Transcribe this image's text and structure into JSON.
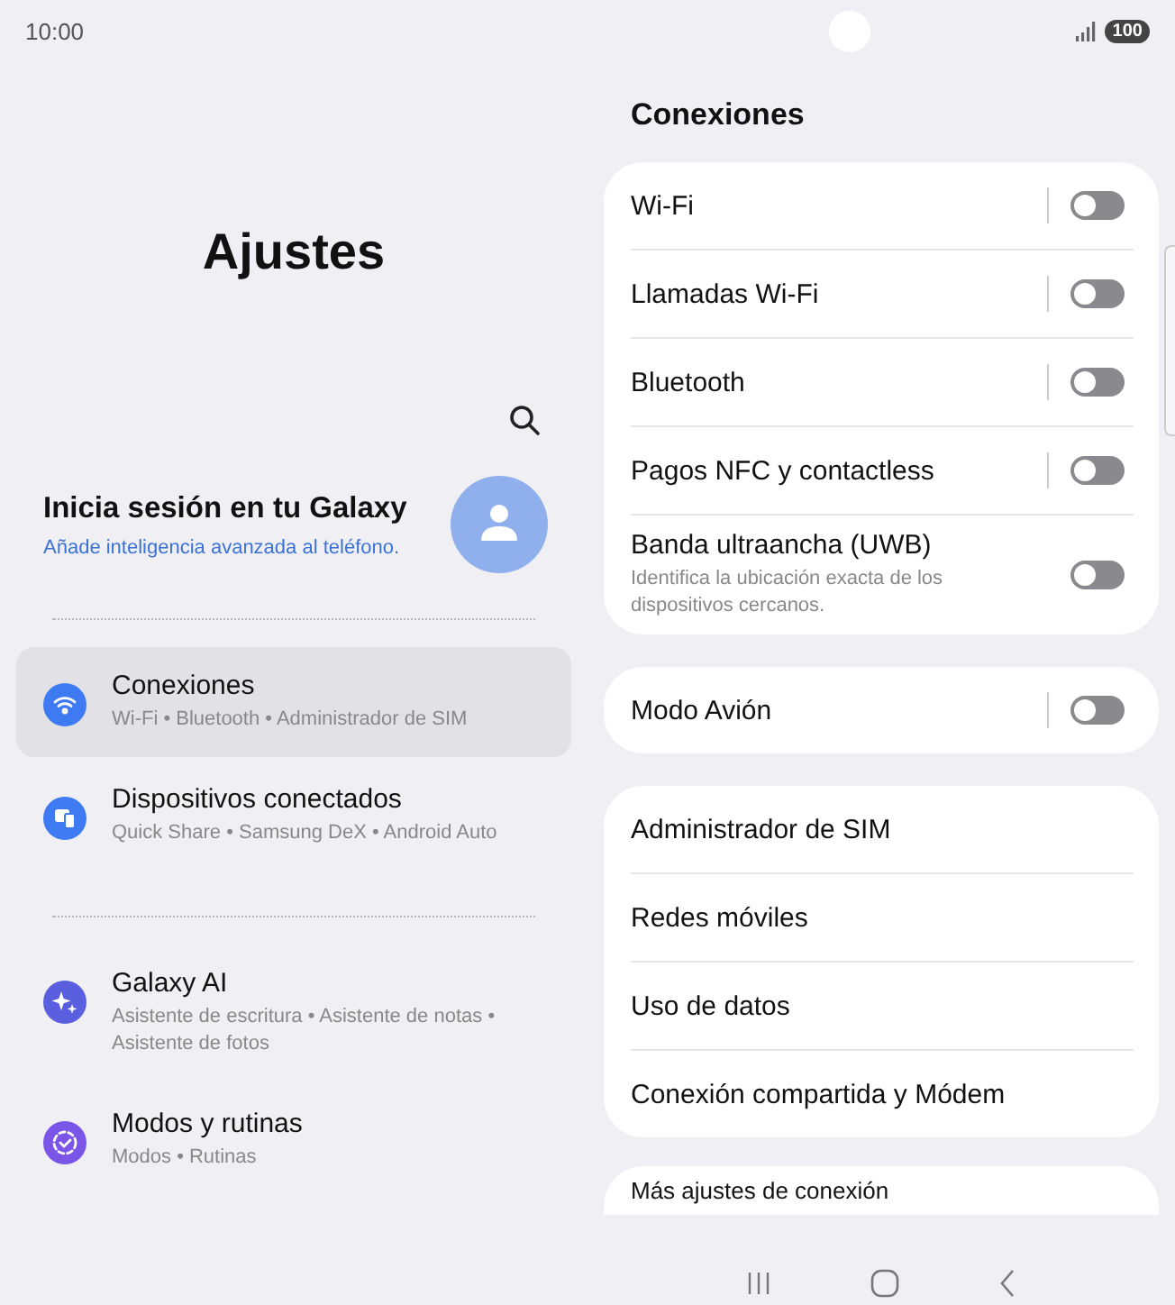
{
  "status_bar": {
    "time": "10:00",
    "battery": "100"
  },
  "sidebar": {
    "title": "Ajustes",
    "account": {
      "title": "Inicia sesión en tu Galaxy",
      "subtitle": "Añade inteligencia avanzada al teléfono."
    },
    "groups": [
      [
        {
          "title": "Conexiones",
          "subtitle": "Wi-Fi  •  Bluetooth  •  Administrador de SIM",
          "kind": "wifi",
          "color": "#3e7bf2",
          "selected": true
        },
        {
          "title": "Dispositivos conectados",
          "subtitle": "Quick Share  •  Samsung DeX  •  Android Auto",
          "kind": "devices",
          "color": "#3e7bf2",
          "selected": false
        }
      ],
      [
        {
          "title": "Galaxy AI",
          "subtitle": "Asistente de escritura  •  Asistente de notas  •  Asistente de fotos",
          "kind": "sparkle",
          "color": "#5a5fe0",
          "selected": false
        },
        {
          "title": "Modos y rutinas",
          "subtitle": "Modos  •  Rutinas",
          "kind": "routine",
          "color": "#7a55e8",
          "selected": false
        }
      ]
    ]
  },
  "detail": {
    "title": "Conexiones",
    "cards": [
      [
        {
          "label": "Wi-Fi",
          "on": false,
          "split": true
        },
        {
          "label": "Llamadas Wi-Fi",
          "on": false,
          "split": true
        },
        {
          "label": "Bluetooth",
          "on": false,
          "split": true
        },
        {
          "label": "Pagos NFC y contactless",
          "on": false,
          "split": true
        },
        {
          "label": "Banda ultraancha (UWB)",
          "description": "Identifica la ubicación exacta de los dispositivos cercanos.",
          "on": false,
          "split": false
        }
      ],
      [
        {
          "label": "Modo Avión",
          "on": false,
          "split": true
        }
      ],
      [
        {
          "label": "Administrador de SIM"
        },
        {
          "label": "Redes móviles"
        },
        {
          "label": "Uso de datos"
        },
        {
          "label": "Conexión compartida y Módem"
        }
      ],
      [
        {
          "label": "Más ajustes de conexión"
        }
      ]
    ]
  }
}
